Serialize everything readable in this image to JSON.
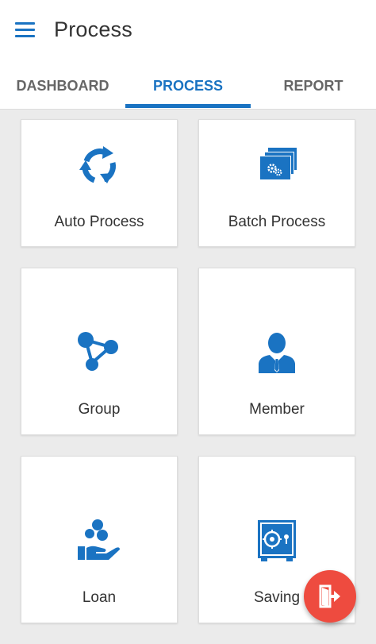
{
  "appbar": {
    "title": "Process",
    "menu_icon": "hamburger-menu-icon"
  },
  "tabs": [
    {
      "label": "DASHBOARD",
      "active": false
    },
    {
      "label": "PROCESS",
      "active": true
    },
    {
      "label": "REPORT",
      "active": false
    }
  ],
  "cards": [
    {
      "label": "Auto Process",
      "icon": "refresh-cycle-icon"
    },
    {
      "label": "Batch Process",
      "icon": "batch-windows-gears-icon"
    },
    {
      "label": "Group",
      "icon": "group-network-icon"
    },
    {
      "label": "Member",
      "icon": "member-person-icon"
    },
    {
      "label": "Loan",
      "icon": "hand-coins-icon"
    },
    {
      "label": "Saving",
      "icon": "safe-vault-icon"
    }
  ],
  "fab": {
    "icon": "logout-exit-icon"
  },
  "colors": {
    "accent": "#1a73c2",
    "fab": "#ee4b3f",
    "background": "#ebebeb"
  }
}
